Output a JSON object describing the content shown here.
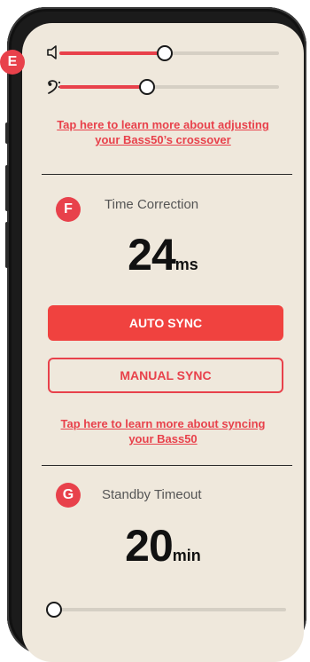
{
  "callouts": {
    "e": "E",
    "f": "F",
    "g": "G"
  },
  "crossover": {
    "treble_slider": {
      "icon": "speaker-icon",
      "level": 0.48
    },
    "bass_slider": {
      "icon": "bass-clef-icon",
      "level": 0.4
    },
    "link_line1": "Tap here to learn more about adjusting",
    "link_line2": "your Bass50’s crossover"
  },
  "time_correction": {
    "title": "Time Correction",
    "value": "24",
    "unit": "ms",
    "auto_sync_label": "AUTO SYNC",
    "manual_sync_label": "MANUAL SYNC",
    "link_line1": "Tap here to learn more about syncing",
    "link_line2": "your Bass50"
  },
  "standby_timeout": {
    "title": "Standby Timeout",
    "value": "20",
    "unit": "min",
    "slider_level": 0.0
  },
  "colors": {
    "accent": "#e8414b",
    "background": "#efe8dc",
    "text": "#111111"
  }
}
